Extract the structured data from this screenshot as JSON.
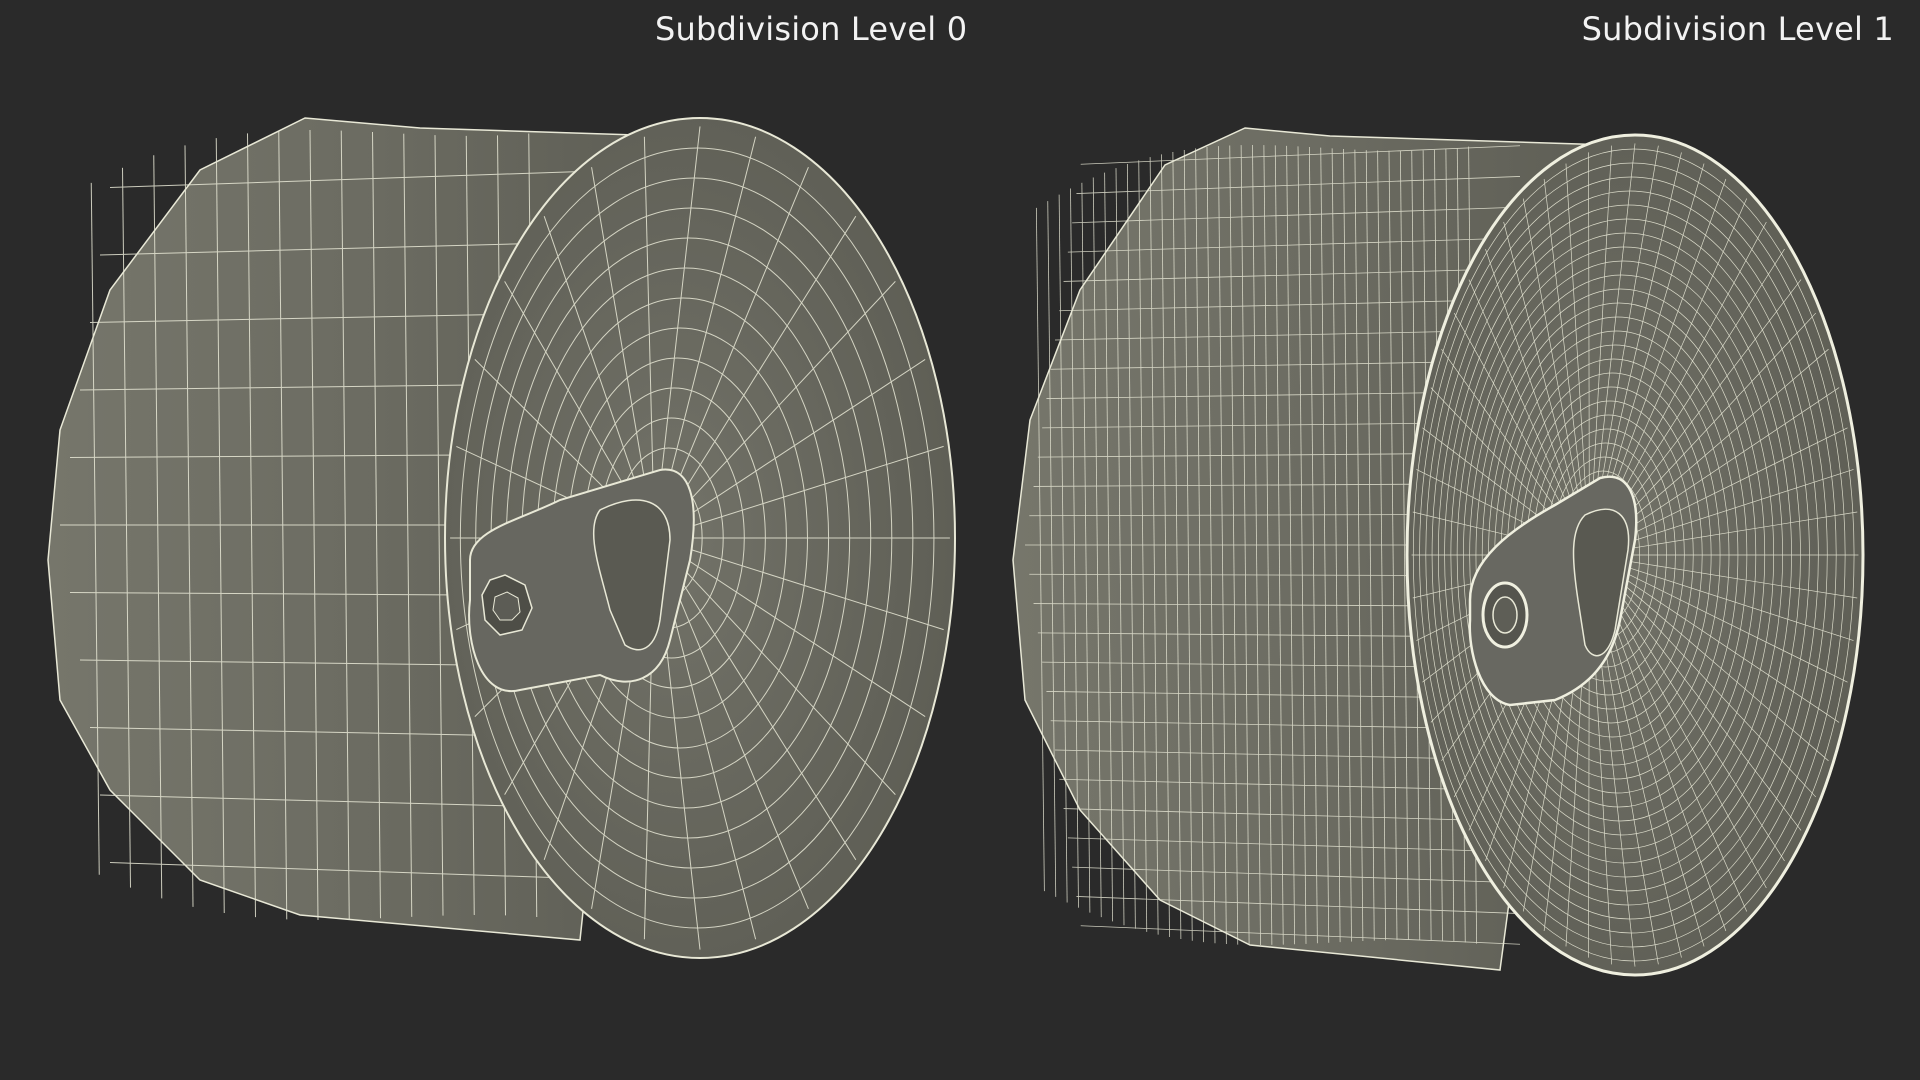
{
  "views": [
    {
      "label": "Subdivision Level 0",
      "subdivision_level": 0
    },
    {
      "label": "Subdivision Level 1",
      "subdivision_level": 1
    }
  ],
  "colors": {
    "background": "#2a2a2a",
    "surface": "#6e6e64",
    "surface_dark": "#55554c",
    "wire": "#e8e8d6",
    "label": "#f2f2f2"
  }
}
